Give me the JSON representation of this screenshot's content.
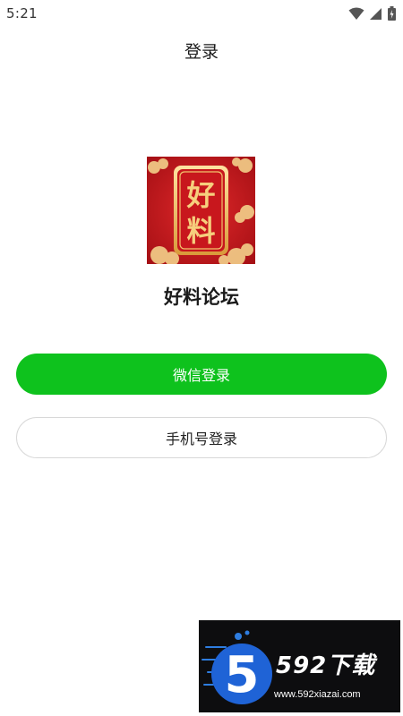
{
  "status_bar": {
    "time": "5:21",
    "icons": [
      "wifi-icon",
      "signal-icon",
      "battery-icon"
    ]
  },
  "header": {
    "title": "登录"
  },
  "app": {
    "logo_text_top": "好",
    "logo_text_bottom": "料",
    "name": "好料论坛"
  },
  "buttons": {
    "wechat_login": "微信登录",
    "phone_login": "手机号登录"
  },
  "watermark": {
    "logo_digit": "5",
    "brand": "592下载",
    "url": "www.592xiazai.com"
  },
  "colors": {
    "wechat_green": "#0ec21d",
    "logo_red": "#c8171d",
    "logo_gold": "#f2c46d"
  }
}
